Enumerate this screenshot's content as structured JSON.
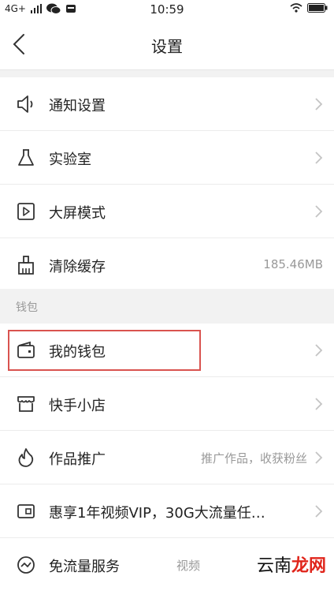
{
  "status_bar": {
    "network": "4G+",
    "time": "10:59"
  },
  "nav": {
    "title": "设置"
  },
  "settings_items": [
    {
      "label": "通知设置",
      "icon": "speaker-icon"
    },
    {
      "label": "实验室",
      "icon": "flask-icon"
    },
    {
      "label": "大屏模式",
      "icon": "play-screen-icon"
    },
    {
      "label": "清除缓存",
      "icon": "broom-icon",
      "value": "185.46MB"
    }
  ],
  "wallet_group": {
    "header": "钱包",
    "items": [
      {
        "label": "我的钱包",
        "icon": "wallet-icon"
      },
      {
        "label": "快手小店",
        "icon": "store-icon"
      },
      {
        "label": "作品推广",
        "icon": "flame-icon",
        "value": "推广作品，收获粉丝"
      },
      {
        "label": "惠享1年视频VIP，30G大流量任…",
        "icon": "vip-card-icon"
      },
      {
        "label": "免流量服务",
        "icon": "trend-icon",
        "value": "视频"
      }
    ]
  },
  "watermark": {
    "prefix": "云南",
    "highlight": "龙网"
  },
  "colors": {
    "highlight_box": "#d9534f",
    "background": "#f2f2f2"
  }
}
